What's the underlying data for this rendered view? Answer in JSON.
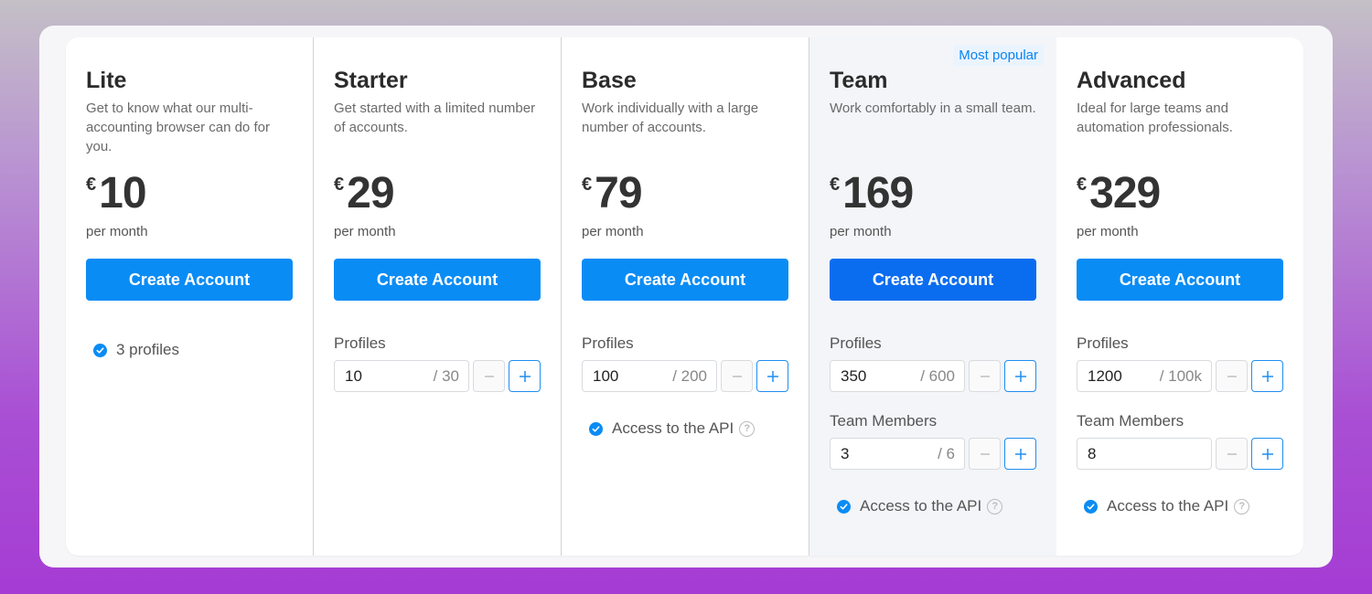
{
  "plans": [
    {
      "name": "Lite",
      "description": "Get to know what our multi-accounting browser can do for you.",
      "currency": "€",
      "price": "10",
      "period": "per month",
      "cta": "Create Account",
      "feature": "3 profiles"
    },
    {
      "name": "Starter",
      "description": "Get started with a limited number of accounts.",
      "currency": "€",
      "price": "29",
      "period": "per month",
      "cta": "Create Account",
      "profiles_label": "Profiles",
      "profiles_value": "10",
      "profiles_max": "/ 30"
    },
    {
      "name": "Base",
      "description": "Work individually with a large number of accounts.",
      "currency": "€",
      "price": "79",
      "period": "per month",
      "cta": "Create Account",
      "profiles_label": "Profiles",
      "profiles_value": "100",
      "profiles_max": "/ 200",
      "api_label": "Access to the API"
    },
    {
      "name": "Team",
      "badge": "Most popular",
      "description": "Work comfortably in a small team.",
      "currency": "€",
      "price": "169",
      "period": "per month",
      "cta": "Create Account",
      "profiles_label": "Profiles",
      "profiles_value": "350",
      "profiles_max": "/ 600",
      "members_label": "Team Members",
      "members_value": "3",
      "members_max": "/ 6",
      "api_label": "Access to the API"
    },
    {
      "name": "Advanced",
      "description": "Ideal for large teams and automation professionals.",
      "currency": "€",
      "price": "329",
      "period": "per month",
      "cta": "Create Account",
      "profiles_label": "Profiles",
      "profiles_value": "1200",
      "profiles_max": "/ 100k",
      "members_label": "Team Members",
      "members_value": "8",
      "api_label": "Access to the API"
    }
  ],
  "colors": {
    "accent": "#0a8cf5",
    "accent_popular": "#0a6df0",
    "badge_text": "#0a84f0",
    "popular_bg": "#f3f5f8"
  },
  "icons": {
    "check": "check-circle-icon",
    "help": "question-circle-icon",
    "minus": "minus-icon",
    "plus": "plus-icon"
  }
}
